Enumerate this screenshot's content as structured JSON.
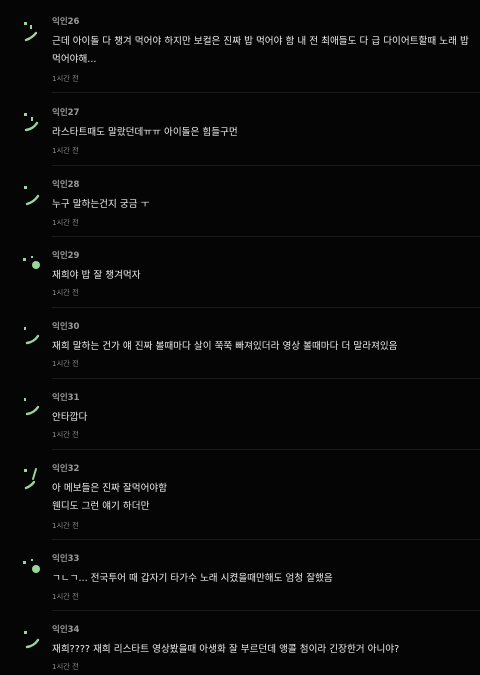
{
  "comments": [
    {
      "author": "익인26",
      "body": "근데 아이돌 다 챙겨 먹어야 하지만 보컬은 진짜 밥 먹어야 함 내 전 최애들도 다 급 다이어트할때 노래 밥 먹어야해...",
      "time": "1시간 전",
      "avatar_color": "#9bd59b"
    },
    {
      "author": "익인27",
      "body": "라스타트때도 말랐던데ㅠㅠ 아이돌은 힘들구먼",
      "time": "1시간 전",
      "avatar_color": "#9bd59b"
    },
    {
      "author": "익인28",
      "body": "누구 말하는건지 궁금 ㅜ",
      "time": "1시간 전",
      "avatar_color": "#9bd59b"
    },
    {
      "author": "익인29",
      "body": "재희야 밥 잘 챙겨먹자",
      "time": "1시간 전",
      "avatar_color": "#9bd59b"
    },
    {
      "author": "익인30",
      "body": "재희 말하는 건가 얘 진짜 볼때마다 살이 쭉쭉 빠져있더라 영상 볼때마다 더 말라져있음",
      "time": "1시간 전",
      "avatar_color": "#9bd59b"
    },
    {
      "author": "익인31",
      "body": "안타깝다",
      "time": "1시간 전",
      "avatar_color": "#9bd59b"
    },
    {
      "author": "익인32",
      "body": "아 메보들은 진짜 잘먹어야함\n웬디도 그런 얘기 하더만",
      "time": "1시간 전",
      "avatar_color": "#9bd59b"
    },
    {
      "author": "익인33",
      "body": "ㄱㄴㄱ... 전국투어 때 갑자기 타가수 노래 시켰을때만해도 엄청 잘했음",
      "time": "1시간 전",
      "avatar_color": "#9bd59b"
    },
    {
      "author": "익인34",
      "body": "재희???? 재희 리스타트 영상봤을때 아생화 잘 부르던데 앵콜 첨이라 긴장한거 아니야?",
      "time": "1시간 전",
      "avatar_color": "#9bd59b"
    }
  ]
}
